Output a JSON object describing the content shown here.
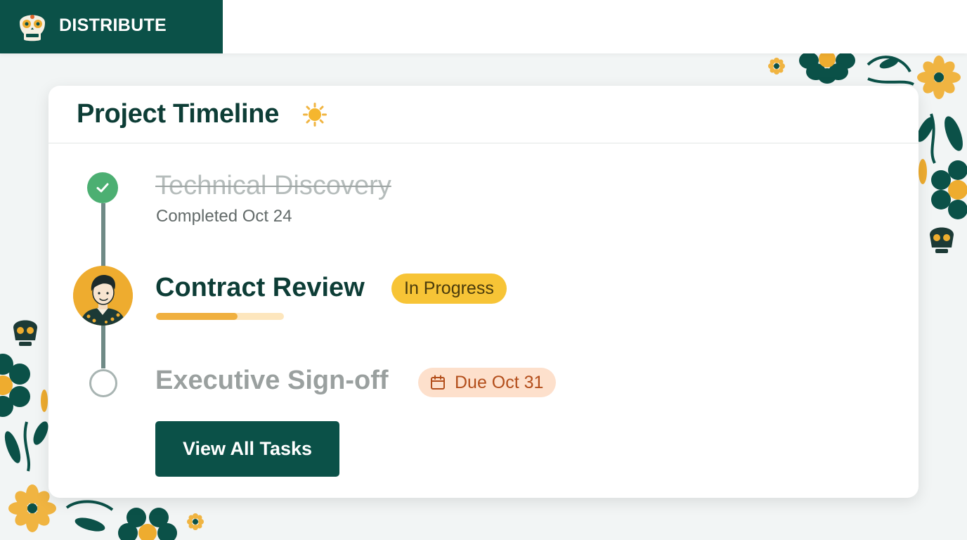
{
  "brand": {
    "name": "DISTRIBUTE",
    "logo_icon": "sugar-skull-icon",
    "color": "#0b5148"
  },
  "card": {
    "title": "Project Timeline",
    "title_icon": "sun-icon"
  },
  "tasks": [
    {
      "title": "Technical Discovery",
      "status": "completed",
      "subtitle": "Completed Oct 24",
      "node_icon": "check-icon",
      "node_color": "#4caf72"
    },
    {
      "title": "Contract Review",
      "status": "in-progress",
      "badge": "In Progress",
      "badge_color": "#f7c436",
      "progress": 0.64,
      "node_icon": "avatar"
    },
    {
      "title": "Executive Sign-off",
      "status": "pending",
      "badge": "Due Oct 31",
      "badge_icon": "calendar-icon",
      "badge_color": "#fde0cc"
    }
  ],
  "actions": {
    "view_all_label": "View All Tasks"
  },
  "colors": {
    "accent": "#0b5148",
    "marigold": "#eeac2f",
    "success": "#4caf72",
    "due": "#b34e1b"
  }
}
